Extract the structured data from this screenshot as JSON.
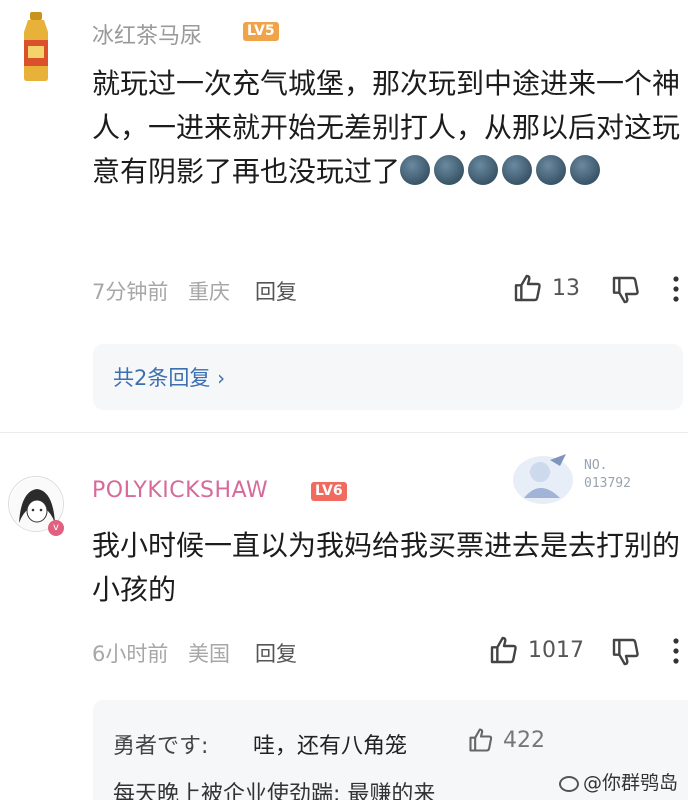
{
  "comments": [
    {
      "username": "冰红茶马尿",
      "level": "LV5",
      "text": "就玩过一次充气城堡，那次玩到中途进来一个神人，一进来就开始无差别打人，从那以后对这玩意有阴影了再也没玩过了",
      "emojis": [
        "moon-face",
        "moon-face",
        "moon-face",
        "moon-face",
        "moon-face",
        "moon-face"
      ],
      "time": "7分钟前",
      "location": "重庆",
      "reply_label": "回复",
      "likes": "13",
      "replies_link": "共2条回复"
    },
    {
      "username": "POLYKICKSHAW",
      "level": "LV6",
      "badge_label": "NO.",
      "badge_number": "013792",
      "text": "我小时候一直以为我妈给我买票进去是去打别的小孩的",
      "time": "6小时前",
      "location": "美国",
      "reply_label": "回复",
      "likes": "1017"
    }
  ],
  "sub_replies": [
    {
      "author": "勇者です:",
      "text": "哇，还有八角笼",
      "likes": "422"
    },
    {
      "author": "",
      "text": "每天晚上被企业使劲踹: 最赚的来",
      "likes": ""
    }
  ],
  "watermark": "@你群鸮岛",
  "colors": {
    "username_gray": "#9a9a9a",
    "username_pink": "#d76a9a",
    "link_blue": "#3c6fb0",
    "lv5": "#f0a348",
    "lv6": "#f06a5e"
  }
}
